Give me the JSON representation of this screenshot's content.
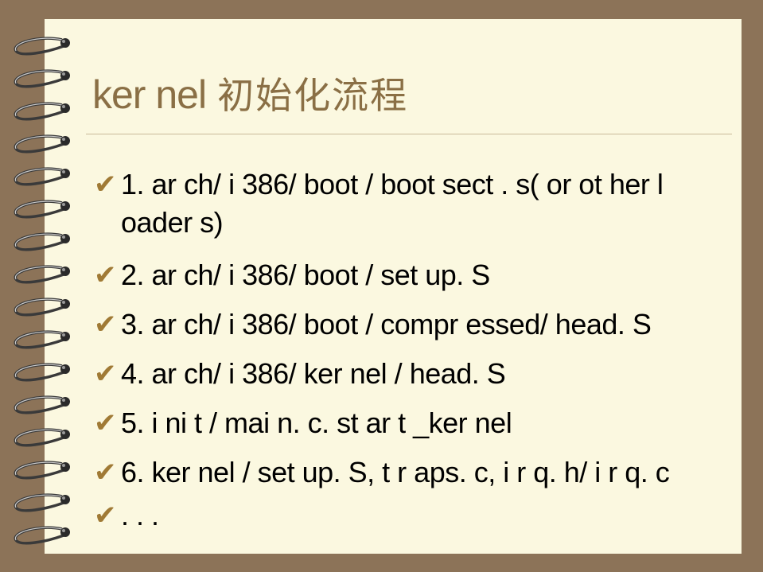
{
  "slide": {
    "title_en": "ker nel",
    "title_cn": "初始化流程"
  },
  "bullet_icon": "check-mark",
  "colors": {
    "frame": "#8c7358",
    "paper": "#fbf8e0",
    "title": "#8a6f45",
    "check": "#a07a35"
  },
  "items": [
    {
      "check": "✔",
      "text": "1. ar ch/ i 386/ boot / boot sect . s( or ot her   l oader s)"
    },
    {
      "check": "✔",
      "text": "2. ar ch/ i 386/ boot / set up. S"
    },
    {
      "check": "✔",
      "text": "3. ar ch/ i 386/ boot / compr essed/ head. S"
    },
    {
      "check": "✔",
      "text": "4. ar ch/ i 386/ ker nel / head. S"
    },
    {
      "check": "✔",
      "text": "5. i ni t / mai n. c. st ar t _ker nel"
    },
    {
      "check": "✔",
      "text": "6. ker nel / set up. S, t r aps. c, i r q. h/ i r q. c"
    },
    {
      "check": "✔",
      "text": ". . ."
    }
  ]
}
